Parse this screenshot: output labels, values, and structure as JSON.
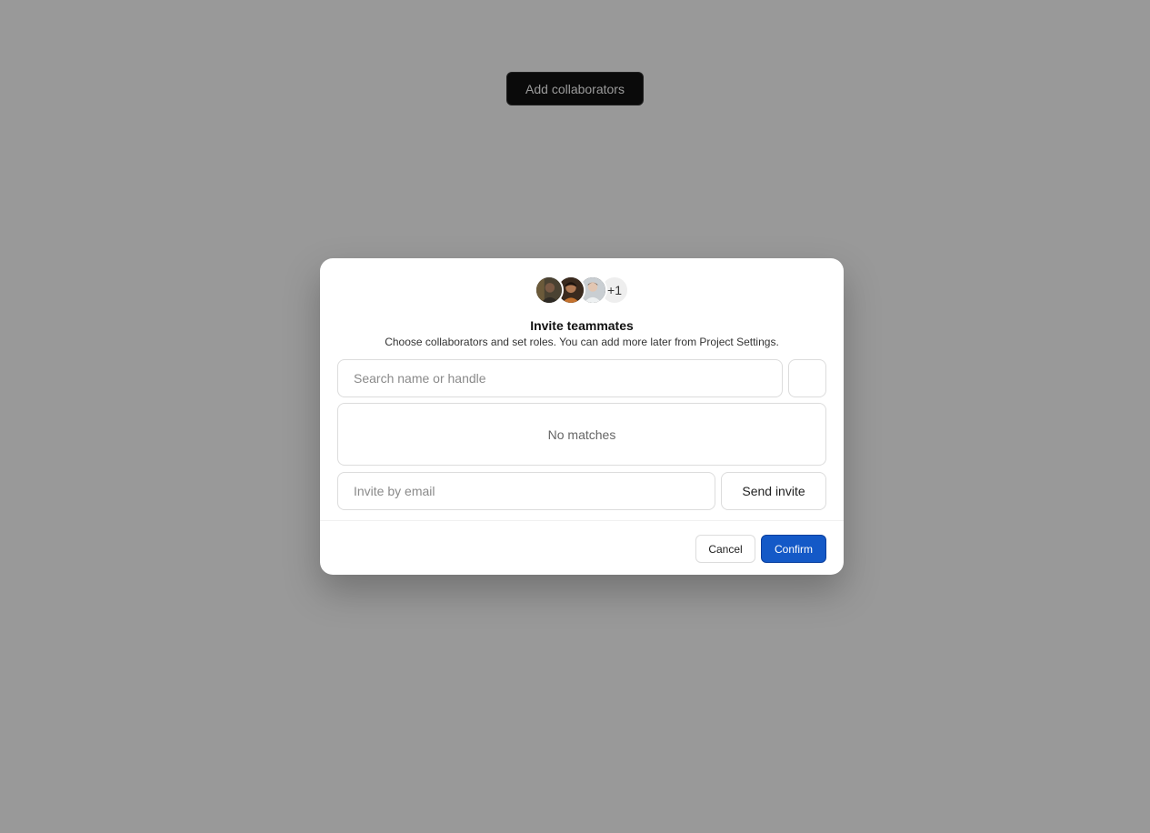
{
  "page": {
    "open_button_label": "Add collaborators"
  },
  "dialog": {
    "avatars": [
      {
        "name": "avatar-1",
        "icon": "person-photo"
      },
      {
        "name": "avatar-2",
        "icon": "person-photo"
      },
      {
        "name": "avatar-3",
        "icon": "person-photo"
      }
    ],
    "more_count": "+1",
    "title": "Invite teammates",
    "subtitle": "Choose collaborators and set roles. You can add more later from Project Settings.",
    "search": {
      "placeholder": "Search name or handle",
      "value": ""
    },
    "results_empty_text": "No matches",
    "email": {
      "placeholder": "Invite by email",
      "value": ""
    },
    "send_invite_label": "Send invite",
    "cancel_label": "Cancel",
    "confirm_label": "Confirm"
  },
  "colors": {
    "overlay": "#999999",
    "page_button_bg": "#111111",
    "primary": "#1459c7"
  }
}
